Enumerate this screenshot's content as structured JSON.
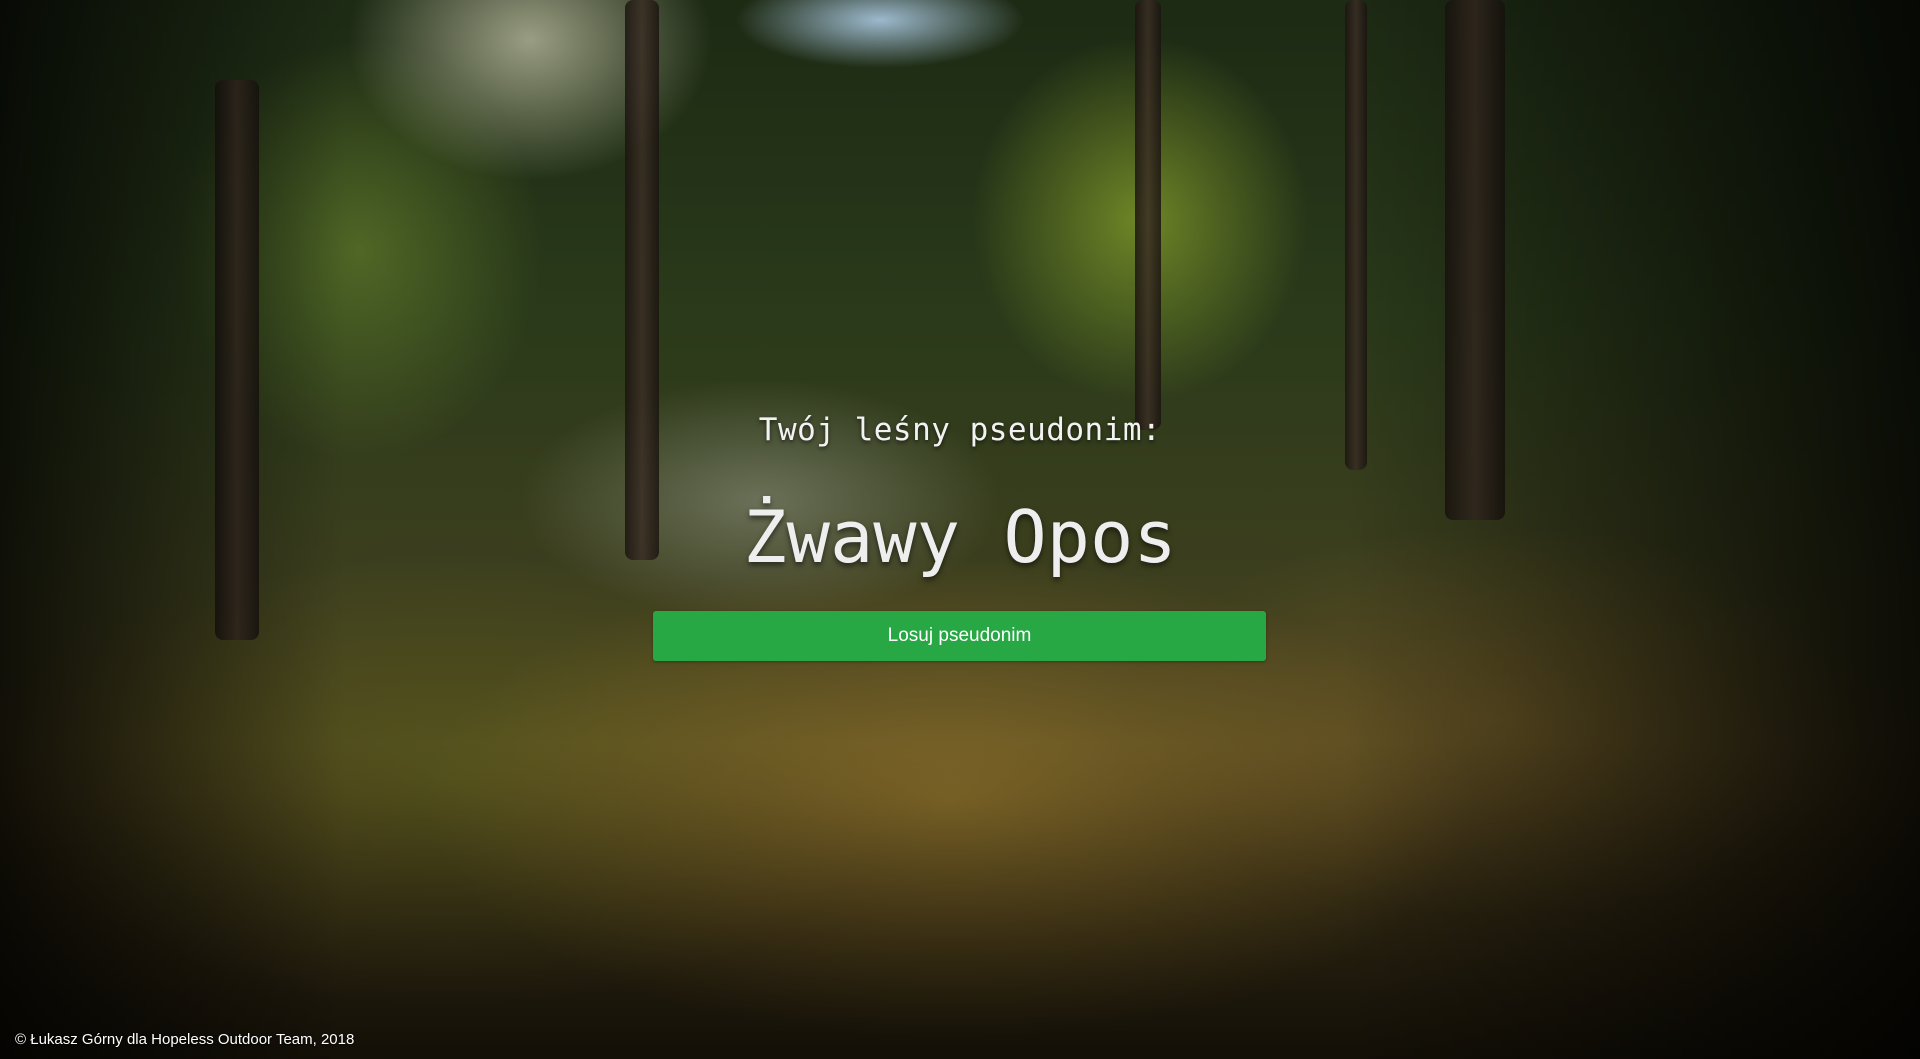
{
  "main": {
    "subtitle": "Twój leśny pseudonim:",
    "nickname": "Żwawy Opos",
    "button_label": "Losuj pseudonim"
  },
  "footer": {
    "copyright_symbol": "©",
    "author": "Łukasz Górny",
    "connector": "dla",
    "team": "Hopeless Outdoor Team, 2018"
  },
  "colors": {
    "button_bg": "#28a745",
    "text": "#ffffff"
  }
}
